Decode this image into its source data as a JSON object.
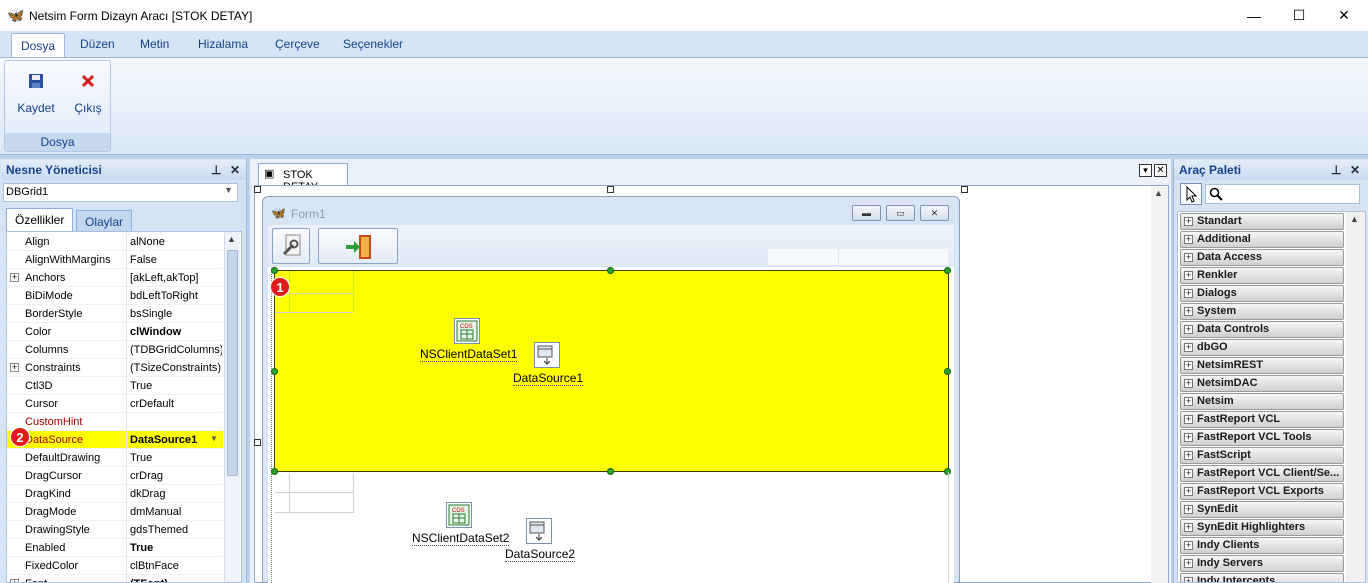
{
  "window": {
    "title": "Netsim Form Dizayn Aracı [STOK DETAY]",
    "minimize": "—",
    "maximize": "☐",
    "close": "✕"
  },
  "ribbon": {
    "tabs": [
      "Dosya",
      "Düzen",
      "Metin",
      "Hizalama",
      "Çerçeve",
      "Seçenekler"
    ],
    "save_label": "Kaydet",
    "exit_label": "Çıkış",
    "group_label": "Dosya"
  },
  "object_inspector": {
    "title": "Nesne Yöneticisi",
    "selected_component": "DBGrid1",
    "tabs": [
      "Özellikler",
      "Olaylar"
    ],
    "properties": [
      {
        "name": "Align",
        "value": "alNone",
        "expandable": false
      },
      {
        "name": "AlignWithMargins",
        "value": "False",
        "expandable": false
      },
      {
        "name": "Anchors",
        "value": "[akLeft,akTop]",
        "expandable": true
      },
      {
        "name": "BiDiMode",
        "value": "bdLeftToRight",
        "expandable": false
      },
      {
        "name": "BorderStyle",
        "value": "bsSingle",
        "expandable": false
      },
      {
        "name": "Color",
        "value": "clWindow",
        "expandable": false,
        "bold": true
      },
      {
        "name": "Columns",
        "value": "(TDBGridColumns)",
        "expandable": false
      },
      {
        "name": "Constraints",
        "value": "(TSizeConstraints)",
        "expandable": true
      },
      {
        "name": "Ctl3D",
        "value": "True",
        "expandable": false
      },
      {
        "name": "Cursor",
        "value": "crDefault",
        "expandable": false
      },
      {
        "name": "CustomHint",
        "value": "",
        "expandable": false,
        "red": true
      },
      {
        "name": "DataSource",
        "value": "DataSource1",
        "expandable": false,
        "red": true,
        "bold": true,
        "highlight": true
      },
      {
        "name": "DefaultDrawing",
        "value": "True",
        "expandable": false
      },
      {
        "name": "DragCursor",
        "value": "crDrag",
        "expandable": false
      },
      {
        "name": "DragKind",
        "value": "dkDrag",
        "expandable": false
      },
      {
        "name": "DragMode",
        "value": "dmManual",
        "expandable": false
      },
      {
        "name": "DrawingStyle",
        "value": "gdsThemed",
        "expandable": false
      },
      {
        "name": "Enabled",
        "value": "True",
        "expandable": false,
        "bold": true
      },
      {
        "name": "FixedColor",
        "value": "clBtnFace",
        "expandable": false
      },
      {
        "name": "Font",
        "value": "(TFont)",
        "expandable": true,
        "bold": true
      }
    ]
  },
  "designer": {
    "tab_label": "STOK DETAY",
    "form_caption": "Form1",
    "components": {
      "ds1_label": "NSClientDataSet1",
      "src1_label": "DataSource1",
      "ds2_label": "NSClientDataSet2",
      "src2_label": "DataSource2"
    },
    "badges": {
      "one": "1",
      "two": "2"
    }
  },
  "tool_palette": {
    "title": "Araç Paleti",
    "search_placeholder": "",
    "categories": [
      "Standart",
      "Additional",
      "Data Access",
      "Renkler",
      "Dialogs",
      "System",
      "Data Controls",
      "dbGO",
      "NetsimREST",
      "NetsimDAC",
      "Netsim",
      "FastReport VCL",
      "FastReport VCL Tools",
      "FastScript",
      "FastReport VCL Client/Se...",
      "FastReport VCL Exports",
      "SynEdit",
      "SynEdit Highlighters",
      "Indy Clients",
      "Indy Servers",
      "Indy Intercepts"
    ]
  },
  "colors": {
    "accent": "#15428b",
    "selection": "#ffff00",
    "badge": "#e11b1b",
    "handle": "#2da02d"
  }
}
